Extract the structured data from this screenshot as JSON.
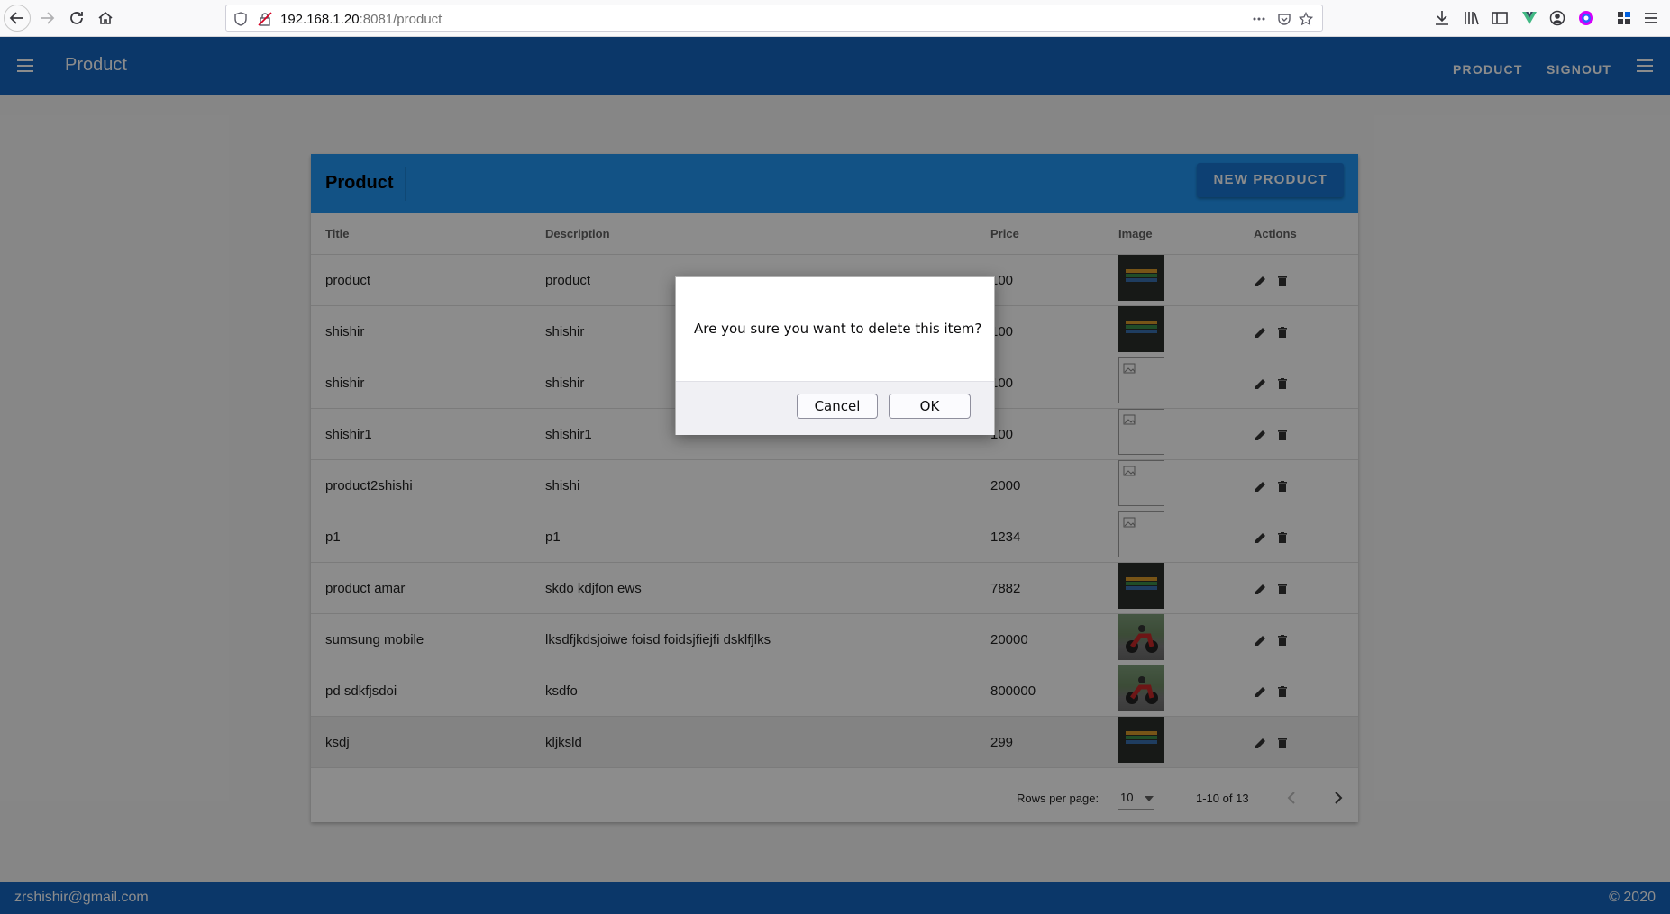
{
  "browser": {
    "url_host": "192.168.1.20",
    "url_rest": ":8081/product"
  },
  "app_bar": {
    "title": "Product",
    "nav_product": "PRODUCT",
    "nav_signout": "SIGNOUT"
  },
  "card": {
    "title": "Product",
    "new_button": "NEW PRODUCT"
  },
  "table": {
    "headers": [
      "Title",
      "Description",
      "Price",
      "Image",
      "Actions"
    ],
    "rows": [
      {
        "title": "product",
        "description": "product",
        "price": "100",
        "image": "dark"
      },
      {
        "title": "shishir",
        "description": "shishir",
        "price": "100",
        "image": "dark"
      },
      {
        "title": "shishir",
        "description": "shishir",
        "price": "100",
        "image": "broken"
      },
      {
        "title": "shishir1",
        "description": "shishir1",
        "price": "100",
        "image": "broken"
      },
      {
        "title": "product2shishi",
        "description": "shishi",
        "price": "2000",
        "image": "broken"
      },
      {
        "title": "p1",
        "description": "p1",
        "price": "1234",
        "image": "broken"
      },
      {
        "title": "product amar",
        "description": "skdo kdjfon ews",
        "price": "7882",
        "image": "dark"
      },
      {
        "title": "sumsung mobile",
        "description": "lksdfjkdsjoiwe foisd foidsjfiejfi dsklfjlks",
        "price": "20000",
        "image": "bike"
      },
      {
        "title": "pd sdkfjsdoi",
        "description": "ksdfo",
        "price": "800000",
        "image": "bike"
      },
      {
        "title": "ksdj",
        "description": "kljksld",
        "price": "299",
        "image": "dark"
      }
    ],
    "rows_per_page_label": "Rows per page:",
    "rows_per_page_value": "10",
    "range_text": "1-10 of 13"
  },
  "dialog": {
    "message": "Are you sure you want to delete this item?",
    "cancel_label": "Cancel",
    "ok_label": "OK"
  },
  "footer": {
    "email": "zrshishir@gmail.com",
    "copyright": "© 2020"
  }
}
